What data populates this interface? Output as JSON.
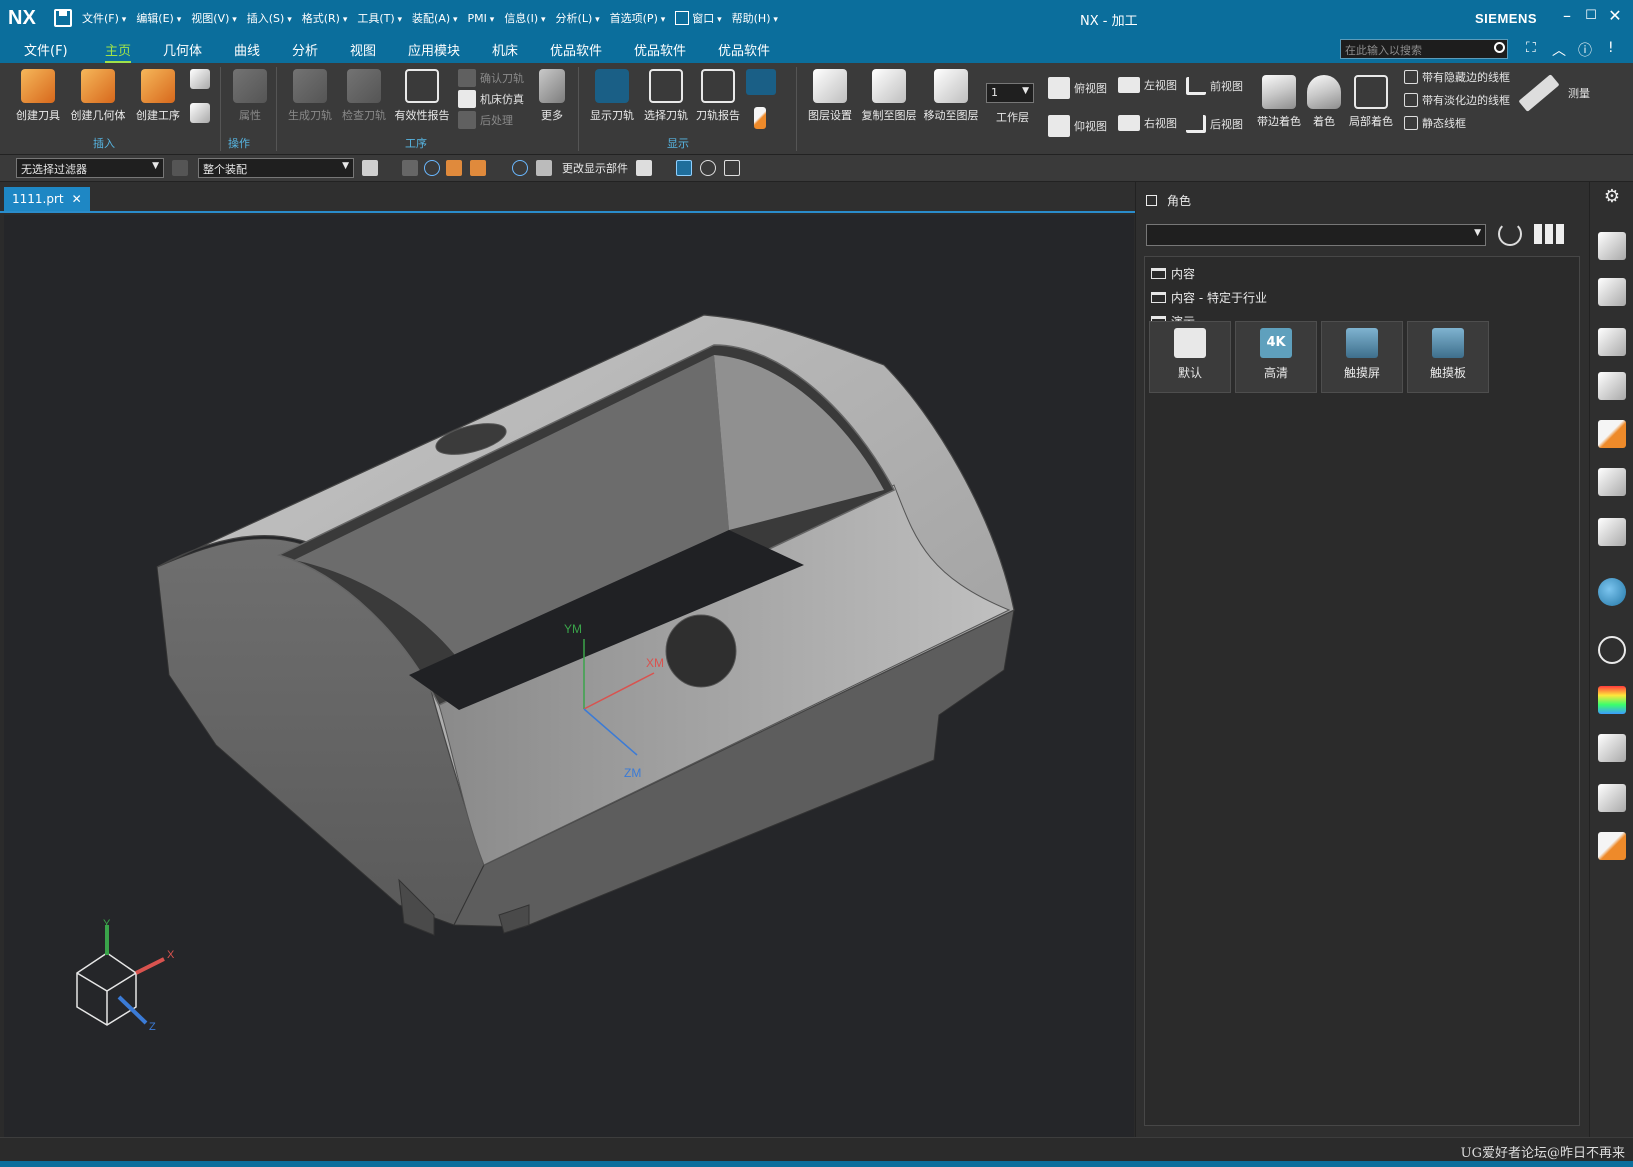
{
  "titlebar": {
    "logo": "NX",
    "menus": [
      "文件(F)",
      "编辑(E)",
      "视图(V)",
      "插入(S)",
      "格式(R)",
      "工具(T)",
      "装配(A)",
      "PMI",
      "信息(I)",
      "分析(L)",
      "首选项(P)",
      "窗口",
      "帮助(H)"
    ],
    "title": "NX - 加工",
    "brand": "SIEMENS",
    "accent": "#0b6e9c"
  },
  "tabs": [
    "文件(F)",
    "主页",
    "几何体",
    "曲线",
    "分析",
    "视图",
    "应用模块",
    "机床",
    "优品软件",
    "优品软件",
    "优品软件"
  ],
  "active_tab": "主页",
  "search_placeholder": "在此输入以搜索",
  "ribbon": {
    "insert": {
      "b1": "创建刀具",
      "b2": "创建几何体",
      "b3": "创建工序",
      "group": "插入"
    },
    "operation": {
      "b1": "属性",
      "group": "操作"
    },
    "procedure": {
      "b1": "生成刀轨",
      "b2": "检查刀轨",
      "b3": "有效性报告",
      "s1": "确认刀轨",
      "s2": "机床仿真",
      "s3": "后处理",
      "b4": "更多",
      "group": "工序"
    },
    "display": {
      "b1": "显示刀轨",
      "b2": "选择刀轨",
      "b3": "刀轨报告",
      "group": "显示"
    },
    "layer": {
      "b1": "图层设置",
      "b2": "复制至图层",
      "b3": "移动至图层",
      "work_layer_value": "1",
      "work_layer_label": "工作层"
    },
    "views": {
      "v1": "俯视图",
      "v2": "左视图",
      "v3": "前视图",
      "v4": "仰视图",
      "v5": "右视图",
      "v6": "后视图"
    },
    "shading": {
      "b1": "带边着色",
      "b2": "着色",
      "b3": "局部着色",
      "s1": "带有隐藏边的线框",
      "s2": "带有淡化边的线框",
      "s3": "静态线框",
      "measure": "测量"
    }
  },
  "selection_bar": {
    "filter": "无选择过滤器",
    "scope": "整个装配",
    "change_display": "更改显示部件"
  },
  "document_tab": "1111.prt",
  "viewport": {
    "wcs": {
      "y": "YM",
      "x": "XM",
      "z": "ZM"
    },
    "triad": {
      "y": "Y",
      "x": "X",
      "z": "Z"
    },
    "background": "#252629"
  },
  "role_panel": {
    "title": "角色",
    "folders": [
      "内容",
      "内容 - 特定于行业",
      "演示"
    ],
    "roles": [
      "默认",
      "高清",
      "触摸屏",
      "触摸板"
    ],
    "role_4k_badge": "4K"
  },
  "watermark": "UG爱好者论坛@昨日不再来"
}
